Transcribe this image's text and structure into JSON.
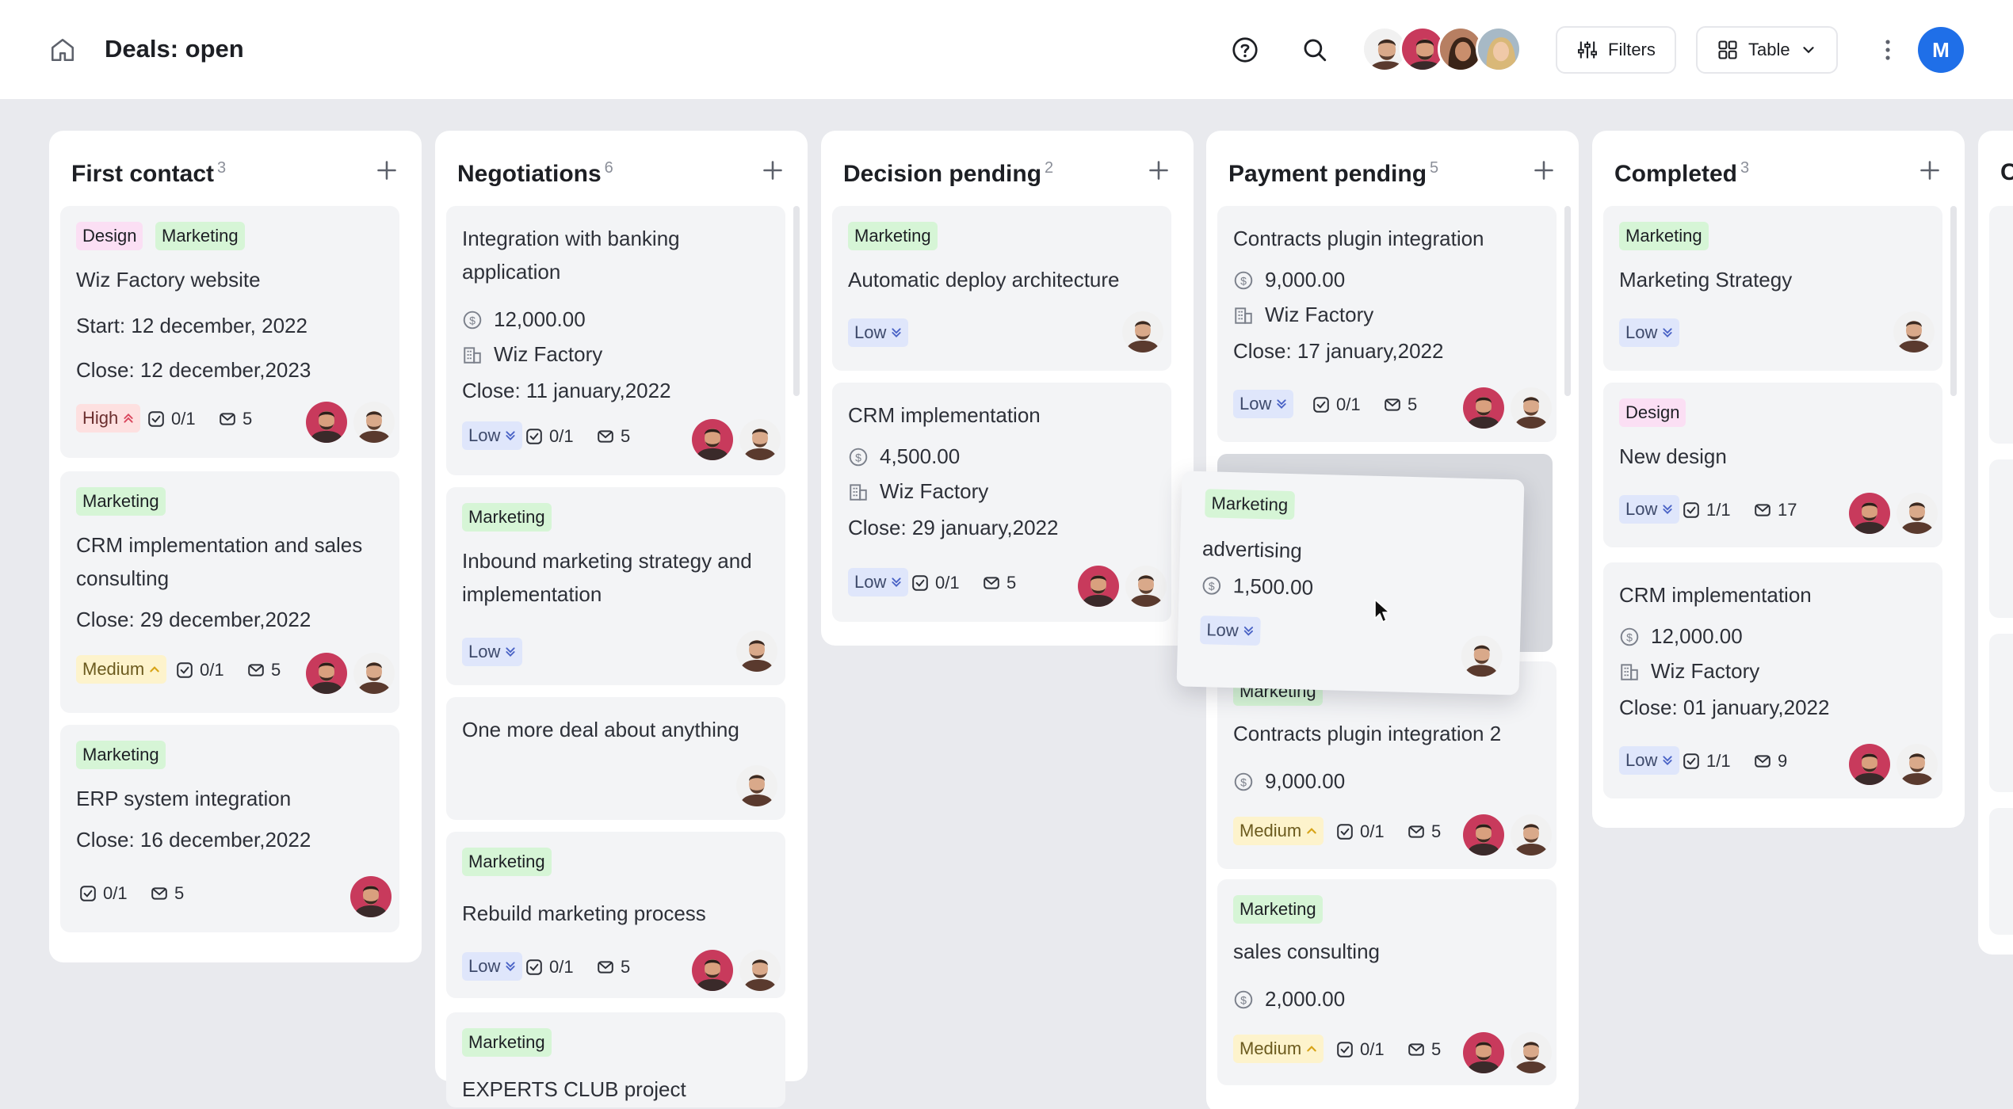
{
  "header": {
    "title": "Deals: open",
    "filters_label": "Filters",
    "view_label": "Table",
    "user_initial": "M"
  },
  "colors": {
    "accent": "#1f6fe8",
    "tag_design": "#fbdff4",
    "tag_marketing": "#d6f5d6",
    "prio_low": "#dfe6fb",
    "prio_high": "#fde0e0",
    "prio_medium": "#fdf3cc"
  },
  "columns": [
    {
      "title": "First contact",
      "count": "3",
      "cards": [
        {
          "tags": [
            "Design",
            "Marketing"
          ],
          "title": "Wiz Factory website",
          "start": "Start: 12 december, 2022",
          "close": "Close: 12 december,2023",
          "priority": "High",
          "tasks": "0/1",
          "messages": "5"
        },
        {
          "tags": [
            "Marketing"
          ],
          "title": "CRM implementation and sales consulting",
          "close": "Close: 29 december,2022",
          "priority": "Medium",
          "tasks": "0/1",
          "messages": "5"
        },
        {
          "tags": [
            "Marketing"
          ],
          "title": "ERP system integration",
          "close": "Close: 16 december,2022",
          "tasks": "0/1",
          "messages": "5"
        }
      ]
    },
    {
      "title": "Negotiations",
      "count": "6",
      "cards": [
        {
          "title": "Integration with banking application",
          "amount": "12,000.00",
          "company": "Wiz Factory",
          "close": "Close: 11 january,2022",
          "priority": "Low",
          "tasks": "0/1",
          "messages": "5"
        },
        {
          "tags": [
            "Marketing"
          ],
          "title": "Inbound marketing strategy and implementation",
          "priority": "Low"
        },
        {
          "title": "One more deal about anything"
        },
        {
          "tags": [
            "Marketing"
          ],
          "title": "Rebuild marketing process",
          "priority": "Low",
          "tasks": "0/1",
          "messages": "5"
        },
        {
          "tags": [
            "Marketing"
          ],
          "title": "EXPERTS CLUB project"
        }
      ]
    },
    {
      "title": "Decision pending",
      "count": "2",
      "cards": [
        {
          "tags": [
            "Marketing"
          ],
          "title": "Automatic deploy architecture",
          "priority": "Low"
        },
        {
          "title": "CRM implementation",
          "amount": "4,500.00",
          "company": "Wiz Factory",
          "close": "Close: 29 january,2022",
          "priority": "Low",
          "tasks": "0/1",
          "messages": "5"
        }
      ]
    },
    {
      "title": "Payment pending",
      "count": "5",
      "cards": [
        {
          "title": "Contracts plugin integration",
          "amount": "9,000.00",
          "company": "Wiz Factory",
          "close": "Close: 17 january,2022",
          "priority": "Low",
          "tasks": "0/1",
          "messages": "5"
        },
        {
          "tags": [
            "Marketing"
          ],
          "title": "Contracts plugin integration 2",
          "amount": "9,000.00",
          "priority": "Medium",
          "tasks": "0/1",
          "messages": "5"
        },
        {
          "tags": [
            "Marketing"
          ],
          "title": "sales consulting",
          "amount": "2,000.00",
          "priority": "Medium",
          "tasks": "0/1",
          "messages": "5"
        }
      ]
    },
    {
      "title": "Completed",
      "count": "3",
      "cards": [
        {
          "tags": [
            "Marketing"
          ],
          "title": "Marketing Strategy",
          "priority": "Low"
        },
        {
          "tags": [
            "Design"
          ],
          "title": "New design",
          "priority": "Low",
          "tasks": "1/1",
          "messages": "17"
        },
        {
          "title": "CRM implementation",
          "amount": "12,000.00",
          "company": "Wiz Factory",
          "close": "Close: 01 january,2022",
          "priority": "Low",
          "tasks": "1/1",
          "messages": "9"
        }
      ]
    }
  ],
  "next_column_partial": "C",
  "dragging_card": {
    "tags": [
      "Marketing"
    ],
    "title": "advertising",
    "amount": "1,500.00",
    "priority": "Low"
  }
}
